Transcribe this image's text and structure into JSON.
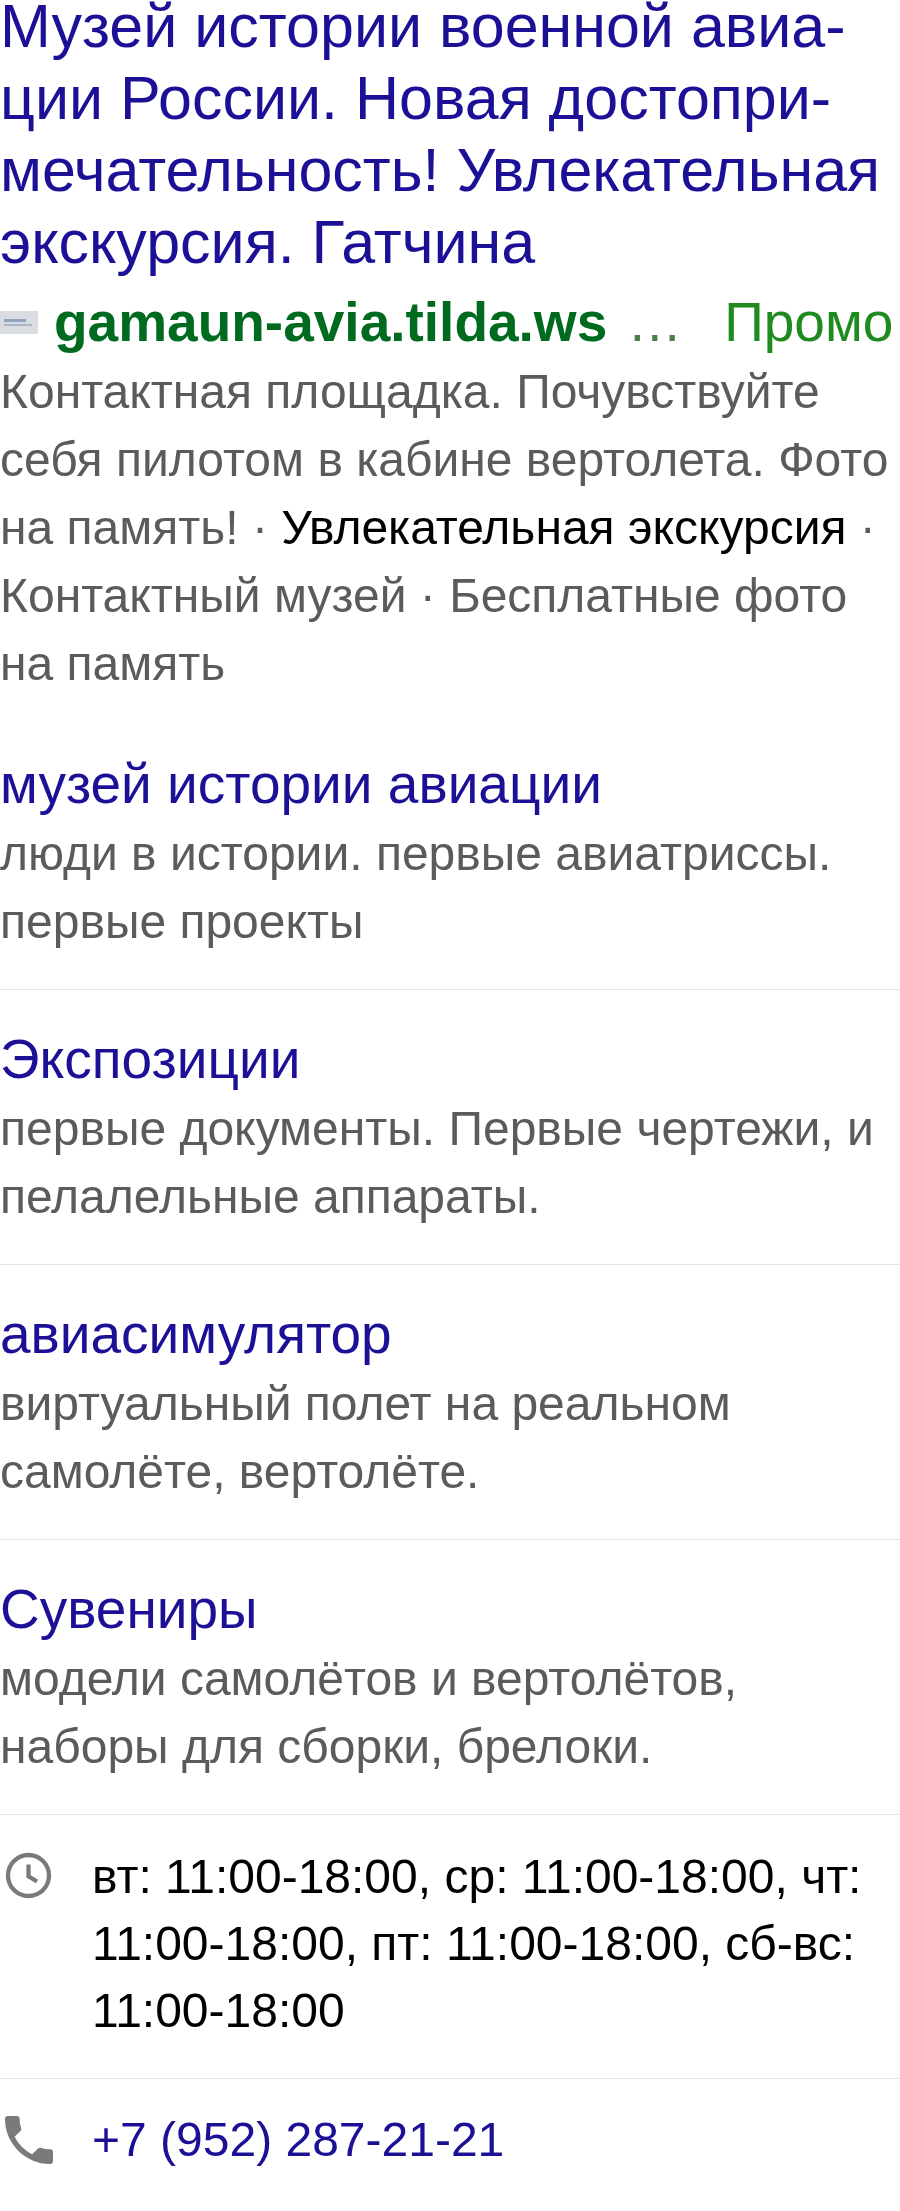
{
  "ad": {
    "title_lines": [
      "Музей истории военной авиа-",
      "ции России. Новая достопри-",
      "мечательность! Увлекательная",
      "экскурсия. Гатчина"
    ],
    "domain": "gamaun-avia.tilda.ws",
    "ellipsis": "…",
    "label": "Промо",
    "text": "Контактная площадка. Почувствуйте себя пилотом в кабине вертолета. Фото на память!",
    "callouts": [
      {
        "separator": "·",
        "text": "Увлекательная экскурсия",
        "kind": "link"
      },
      {
        "separator": "·",
        "text": "Контактный музей",
        "kind": "plain"
      },
      {
        "separator": "·",
        "text": "Бесплатные фото на память",
        "kind": "plain"
      }
    ]
  },
  "sitelinks": [
    {
      "title": "музей истории авиации",
      "text": "люди в истории. первые авиатриссы. первые проекты"
    },
    {
      "title": "Экспозиции",
      "text": "первые документы. Первые чертежи, и пелалельные аппараты."
    },
    {
      "title": "авиасимулятор",
      "text": "виртуальный полет на реальном самолёте, вертолёте."
    },
    {
      "title": "Сувениры",
      "text": "модели самолётов и вертолётов, наборы для сборки, брелоки."
    }
  ],
  "hours": {
    "text": "вт: 11:00-18:00, ср: 11:00-18:00, чт: 11:00-18:00, пт: 11:00-18:00, сб-вс: 11:00-18:00"
  },
  "phone": {
    "number": "+7 (952) 287-21-21"
  }
}
